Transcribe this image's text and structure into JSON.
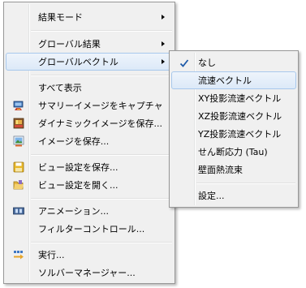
{
  "main_menu": {
    "items": [
      {
        "label": "結果モード"
      },
      {
        "label": "グローバル結果"
      },
      {
        "label": "グローバルベクトル"
      },
      {
        "label": "すべて表示"
      },
      {
        "label": "サマリーイメージをキャプチャ"
      },
      {
        "label": "ダイナミックイメージを保存..."
      },
      {
        "label": "イメージを保存..."
      },
      {
        "label": "ビュー設定を保存..."
      },
      {
        "label": "ビュー設定を開く..."
      },
      {
        "label": "アニメーション..."
      },
      {
        "label": "フィルターコントロール..."
      },
      {
        "label": "実行..."
      },
      {
        "label": "ソルバーマネージャー..."
      }
    ],
    "icons": {
      "capture": "camera-icon",
      "dynamic": "film-save-icon",
      "save_image": "image-save-icon",
      "save_view": "floppy-disk-icon",
      "open_view": "folder-open-icon",
      "animation": "film-strip-icon",
      "run": "run-arrow-icon"
    }
  },
  "submenu": {
    "items": [
      {
        "label": "なし",
        "checked": true
      },
      {
        "label": "流速ベクトル"
      },
      {
        "label": "XY投影流速ベクトル"
      },
      {
        "label": "XZ投影流速ベクトル"
      },
      {
        "label": "YZ投影流速ベクトル"
      },
      {
        "label": "せん断応力 (Tau)"
      },
      {
        "label": "壁面熱流束"
      },
      {
        "label": "設定..."
      }
    ]
  },
  "colors": {
    "menu_bg": "#f0f0f0",
    "highlight": "#dce9f8",
    "highlight_border": "#a8c8ec",
    "check": "#1e5aa8"
  }
}
